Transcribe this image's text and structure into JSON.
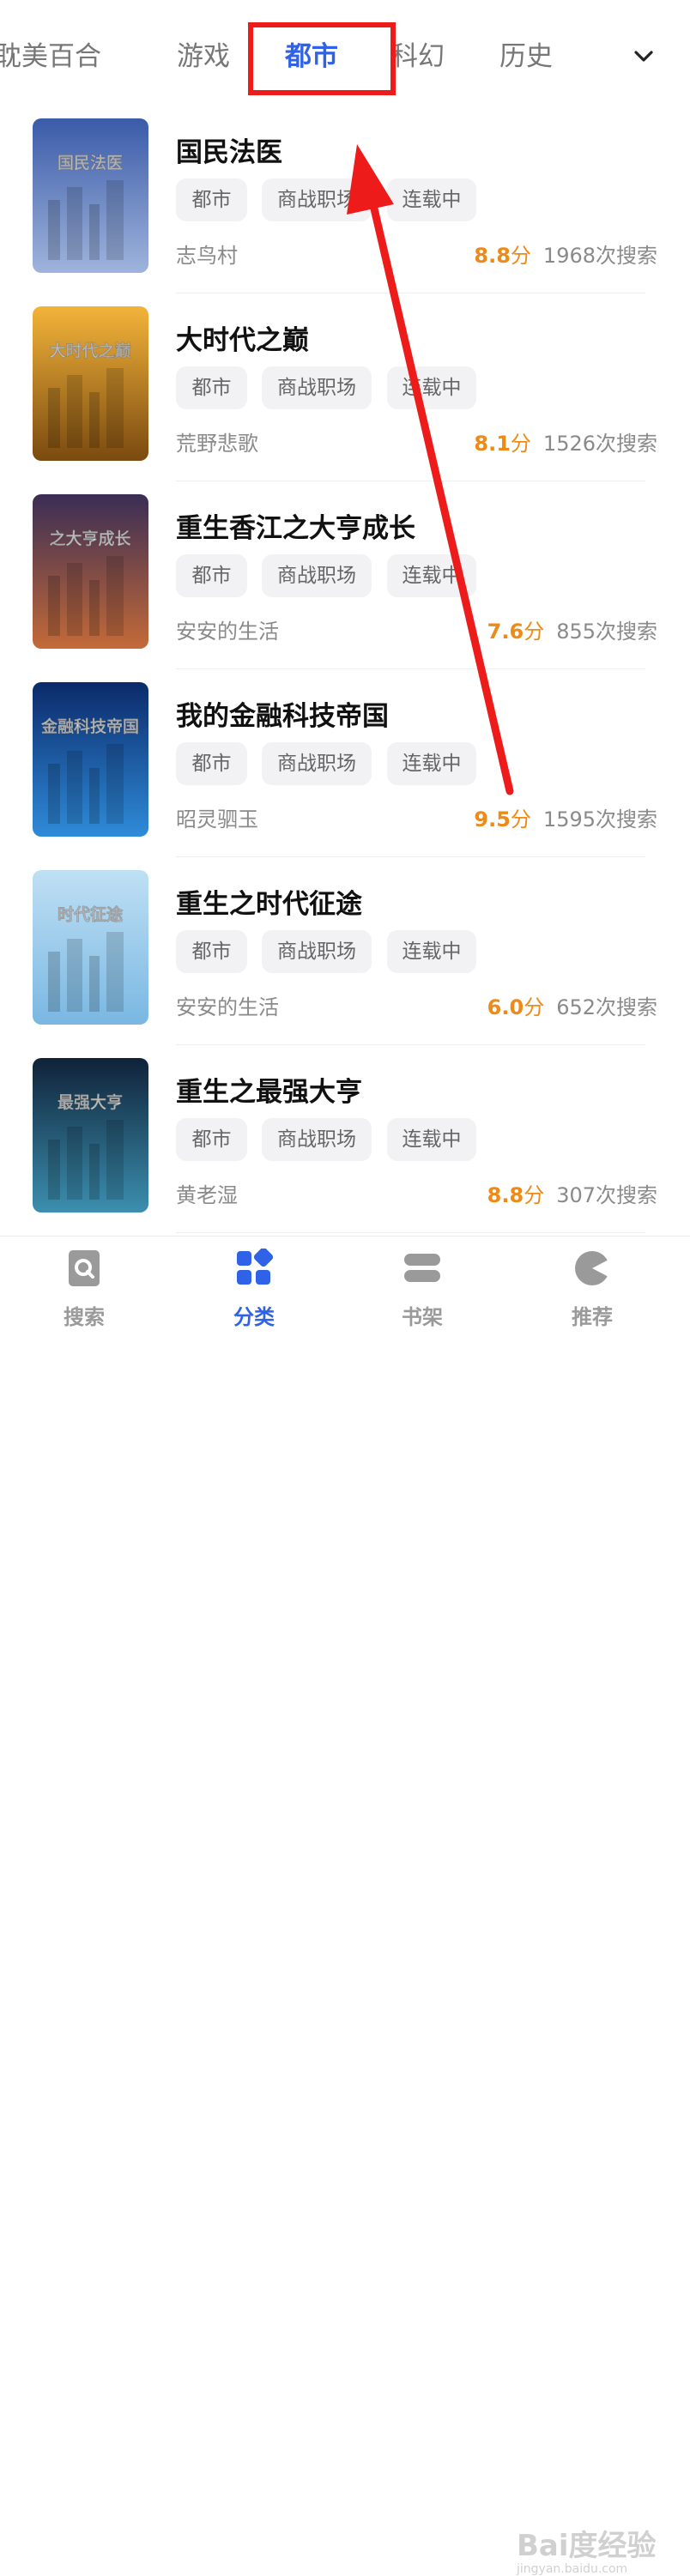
{
  "tabs": [
    {
      "label": "耽美百合",
      "active": false
    },
    {
      "label": "游戏",
      "active": false
    },
    {
      "label": "都市",
      "active": true
    },
    {
      "label": "科幻",
      "active": false
    },
    {
      "label": "历史",
      "active": false
    }
  ],
  "tabs_expand_icon": "chevron-down-icon",
  "books": [
    {
      "title": "国民法医",
      "tags": [
        "都市",
        "商战职场",
        "连载中"
      ],
      "author": "志鸟村",
      "score": "8.8",
      "score_unit": "分",
      "searches": "1968次搜索",
      "cover": {
        "text": "国民法医",
        "colors": [
          "#3b5ba8",
          "#9fb4dc"
        ]
      }
    },
    {
      "title": "大时代之巅",
      "tags": [
        "都市",
        "商战职场",
        "连载中"
      ],
      "author": "荒野悲歌",
      "score": "8.1",
      "score_unit": "分",
      "searches": "1526次搜索",
      "cover": {
        "text": "大时代之巅",
        "colors": [
          "#f3b43a",
          "#7a4a10"
        ]
      }
    },
    {
      "title": "重生香江之大亨成长",
      "tags": [
        "都市",
        "商战职场",
        "连载中"
      ],
      "author": "安安的生活",
      "score": "7.6",
      "score_unit": "分",
      "searches": "855次搜索",
      "cover": {
        "text": "之大亨成长",
        "colors": [
          "#3a2d55",
          "#c46a38"
        ]
      }
    },
    {
      "title": "我的金融科技帝国",
      "tags": [
        "都市",
        "商战职场",
        "连载中"
      ],
      "author": "昭灵驷玉",
      "score": "9.5",
      "score_unit": "分",
      "searches": "1595次搜索",
      "cover": {
        "text": "金融科技帝国",
        "colors": [
          "#0b2a6a",
          "#2f8bd9"
        ]
      }
    },
    {
      "title": "重生之时代征途",
      "tags": [
        "都市",
        "商战职场",
        "连载中"
      ],
      "author": "安安的生活",
      "score": "6.0",
      "score_unit": "分",
      "searches": "652次搜索",
      "cover": {
        "text": "时代征途",
        "colors": [
          "#bfe0f4",
          "#79b7e2"
        ]
      }
    },
    {
      "title": "重生之最强大亨",
      "tags": [
        "都市",
        "商战职场",
        "连载中"
      ],
      "author": "黄老湿",
      "score": "8.8",
      "score_unit": "分",
      "searches": "307次搜索",
      "cover": {
        "text": "最强大亨",
        "colors": [
          "#0f2238",
          "#3c8fb0"
        ]
      }
    }
  ],
  "bottom_nav": [
    {
      "label": "搜索",
      "icon": "search-book-icon",
      "active": false
    },
    {
      "label": "分类",
      "icon": "category-grid-icon",
      "active": true
    },
    {
      "label": "书架",
      "icon": "bookshelf-icon",
      "active": false
    },
    {
      "label": "推荐",
      "icon": "recommend-icon",
      "active": false
    }
  ],
  "colors": {
    "accent": "#2f62e6",
    "score": "#ee8a18",
    "annotation": "#ee1b1b"
  },
  "watermark": {
    "text": "Bai度经验",
    "sub": "jingyan.baidu.com"
  }
}
